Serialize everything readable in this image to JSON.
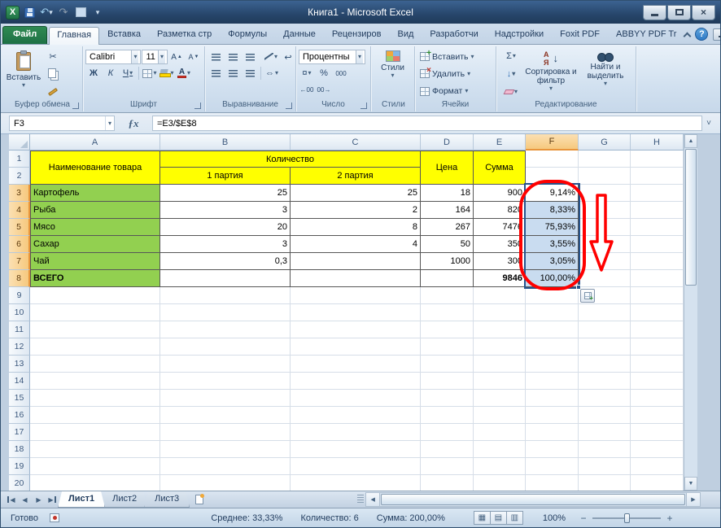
{
  "window": {
    "title": "Книга1  -  Microsoft Excel"
  },
  "icons": {
    "dropdown": "▾",
    "undo": "↶",
    "redo": "↷",
    "cut": "✂",
    "sigma": "Σ",
    "fx": "ƒx",
    "expand_formula": "˅",
    "help": "?",
    "close": "×",
    "up": "▲",
    "down": "▼",
    "left": "◀",
    "right": "▶",
    "wrap_text": "↩",
    "merge_cells": "⇔",
    "grow_font": "А",
    "shrink_font": "А",
    "sort_a": "А",
    "sort_z": "Я",
    "sort_arrow": "↓",
    "fill_down": "↓",
    "zoom_out": "−",
    "zoom_in": "+",
    "view_normal": "▦",
    "view_layout": "▤",
    "view_break": "▥",
    "plus": "+",
    "cross": "×",
    "font_color_letter": "А"
  },
  "ribbon": {
    "tabs": [
      "Файл",
      "Главная",
      "Вставка",
      "Разметка стр",
      "Формулы",
      "Данные",
      "Рецензиров",
      "Вид",
      "Разработчи",
      "Надстройки",
      "Foxit PDF",
      "ABBYY PDF Tr"
    ],
    "active_tab": "Главная",
    "file_tab": "Файл",
    "clipboard": {
      "group": "Буфер обмена",
      "paste": "Вставить"
    },
    "font": {
      "group": "Шрифт",
      "name": "Calibri",
      "size": "11",
      "bold": "Ж",
      "italic": "К",
      "underline": "Ч"
    },
    "alignment": {
      "group": "Выравнивание"
    },
    "number": {
      "group": "Число",
      "format": "Процентны",
      "currency": "¤",
      "percent": "%",
      "zeros": "000",
      "inc_decimal": "←00",
      "dec_decimal": "00→"
    },
    "styles": {
      "group": "Стили",
      "button": "Стили"
    },
    "cells": {
      "group": "Ячейки",
      "insert": "Вставить",
      "delete": "Удалить",
      "format": "Формат"
    },
    "editing": {
      "group": "Редактирование",
      "sort": "Сортировка и фильтр",
      "find": "Найти и выделить"
    }
  },
  "formula_bar": {
    "cell_ref": "F3",
    "formula": "=E3/$E$8"
  },
  "colors": {
    "header_yellow": "#FFFF00",
    "row_green": "#92D050",
    "selection_fill": "#C9DCF0",
    "selection_border": "#26538C",
    "annotation_red": "#FF0000"
  },
  "sheet": {
    "columns": [
      "A",
      "B",
      "C",
      "D",
      "E",
      "F",
      "G",
      "H"
    ],
    "rows": 20,
    "selected_column": "F",
    "selected_rows_from": 3,
    "selected_rows_to": 8,
    "cells": [
      {
        "r": 1,
        "c": 1,
        "rs": 2,
        "t": "Наименование товара",
        "bg": "yellow",
        "al": "center",
        "tb": true
      },
      {
        "r": 1,
        "c": 2,
        "cs": 2,
        "t": "Количество",
        "bg": "yellow",
        "al": "center",
        "tb": true
      },
      {
        "r": 1,
        "c": 4,
        "rs": 2,
        "t": "Цена",
        "bg": "yellow",
        "al": "center",
        "tb": true
      },
      {
        "r": 1,
        "c": 5,
        "rs": 2,
        "t": "Сумма",
        "bg": "yellow",
        "al": "center",
        "tb": true
      },
      {
        "r": 2,
        "c": 2,
        "t": "1 партия",
        "bg": "yellow",
        "al": "center",
        "tb": true
      },
      {
        "r": 2,
        "c": 3,
        "t": "2 партия",
        "bg": "yellow",
        "al": "center",
        "tb": true
      },
      {
        "r": 3,
        "c": 1,
        "t": "Картофель",
        "bg": "green",
        "tb": true
      },
      {
        "r": 3,
        "c": 2,
        "t": "25",
        "al": "right",
        "tb": true
      },
      {
        "r": 3,
        "c": 3,
        "t": "25",
        "al": "right",
        "tb": true
      },
      {
        "r": 3,
        "c": 4,
        "t": "18",
        "al": "right",
        "tb": true
      },
      {
        "r": 3,
        "c": 5,
        "t": "900",
        "al": "right",
        "tb": true
      },
      {
        "r": 3,
        "c": 6,
        "t": "9,14%",
        "al": "right",
        "sel": "active",
        "tb": true
      },
      {
        "r": 4,
        "c": 1,
        "t": "Рыба",
        "bg": "green",
        "tb": true
      },
      {
        "r": 4,
        "c": 2,
        "t": "3",
        "al": "right",
        "tb": true
      },
      {
        "r": 4,
        "c": 3,
        "t": "2",
        "al": "right",
        "tb": true
      },
      {
        "r": 4,
        "c": 4,
        "t": "164",
        "al": "right",
        "tb": true
      },
      {
        "r": 4,
        "c": 5,
        "t": "820",
        "al": "right",
        "tb": true
      },
      {
        "r": 4,
        "c": 6,
        "t": "8,33%",
        "al": "right",
        "sel": "blue",
        "tb": true
      },
      {
        "r": 5,
        "c": 1,
        "t": "Мясо",
        "bg": "green",
        "tb": true
      },
      {
        "r": 5,
        "c": 2,
        "t": "20",
        "al": "right",
        "tb": true
      },
      {
        "r": 5,
        "c": 3,
        "t": "8",
        "al": "right",
        "tb": true
      },
      {
        "r": 5,
        "c": 4,
        "t": "267",
        "al": "right",
        "tb": true
      },
      {
        "r": 5,
        "c": 5,
        "t": "7476",
        "al": "right",
        "tb": true
      },
      {
        "r": 5,
        "c": 6,
        "t": "75,93%",
        "al": "right",
        "sel": "blue",
        "tb": true
      },
      {
        "r": 6,
        "c": 1,
        "t": "Сахар",
        "bg": "green",
        "tb": true
      },
      {
        "r": 6,
        "c": 2,
        "t": "3",
        "al": "right",
        "tb": true
      },
      {
        "r": 6,
        "c": 3,
        "t": "4",
        "al": "right",
        "tb": true
      },
      {
        "r": 6,
        "c": 4,
        "t": "50",
        "al": "right",
        "tb": true
      },
      {
        "r": 6,
        "c": 5,
        "t": "350",
        "al": "right",
        "tb": true
      },
      {
        "r": 6,
        "c": 6,
        "t": "3,55%",
        "al": "right",
        "sel": "blue",
        "tb": true
      },
      {
        "r": 7,
        "c": 1,
        "t": "Чай",
        "bg": "green",
        "tb": true
      },
      {
        "r": 7,
        "c": 2,
        "t": "0,3",
        "al": "right",
        "tb": true
      },
      {
        "r": 7,
        "c": 3,
        "t": "",
        "tb": true
      },
      {
        "r": 7,
        "c": 4,
        "t": "1000",
        "al": "right",
        "tb": true
      },
      {
        "r": 7,
        "c": 5,
        "t": "300",
        "al": "right",
        "tb": true
      },
      {
        "r": 7,
        "c": 6,
        "t": "3,05%",
        "al": "right",
        "sel": "blue",
        "tb": true
      },
      {
        "r": 8,
        "c": 1,
        "t": "ВСЕГО",
        "bg": "green",
        "b": true,
        "tb": true
      },
      {
        "r": 8,
        "c": 2,
        "t": "",
        "tb": true
      },
      {
        "r": 8,
        "c": 3,
        "t": "",
        "tb": true
      },
      {
        "r": 8,
        "c": 4,
        "t": "",
        "tb": true
      },
      {
        "r": 8,
        "c": 5,
        "t": "9846",
        "al": "right",
        "b": true,
        "tb": true
      },
      {
        "r": 8,
        "c": 6,
        "t": "100,00%",
        "al": "right",
        "sel": "blue",
        "tb": true
      }
    ]
  },
  "sheet_tabs": {
    "tabs": [
      {
        "label": "Лист1",
        "active": true
      },
      {
        "label": "Лист2",
        "active": false
      },
      {
        "label": "Лист3",
        "active": false
      }
    ]
  },
  "status_bar": {
    "mode": "Готово",
    "average": "Среднее: 33,33%",
    "count": "Количество: 6",
    "sum": "Сумма: 200,00%",
    "zoom": "100%"
  }
}
